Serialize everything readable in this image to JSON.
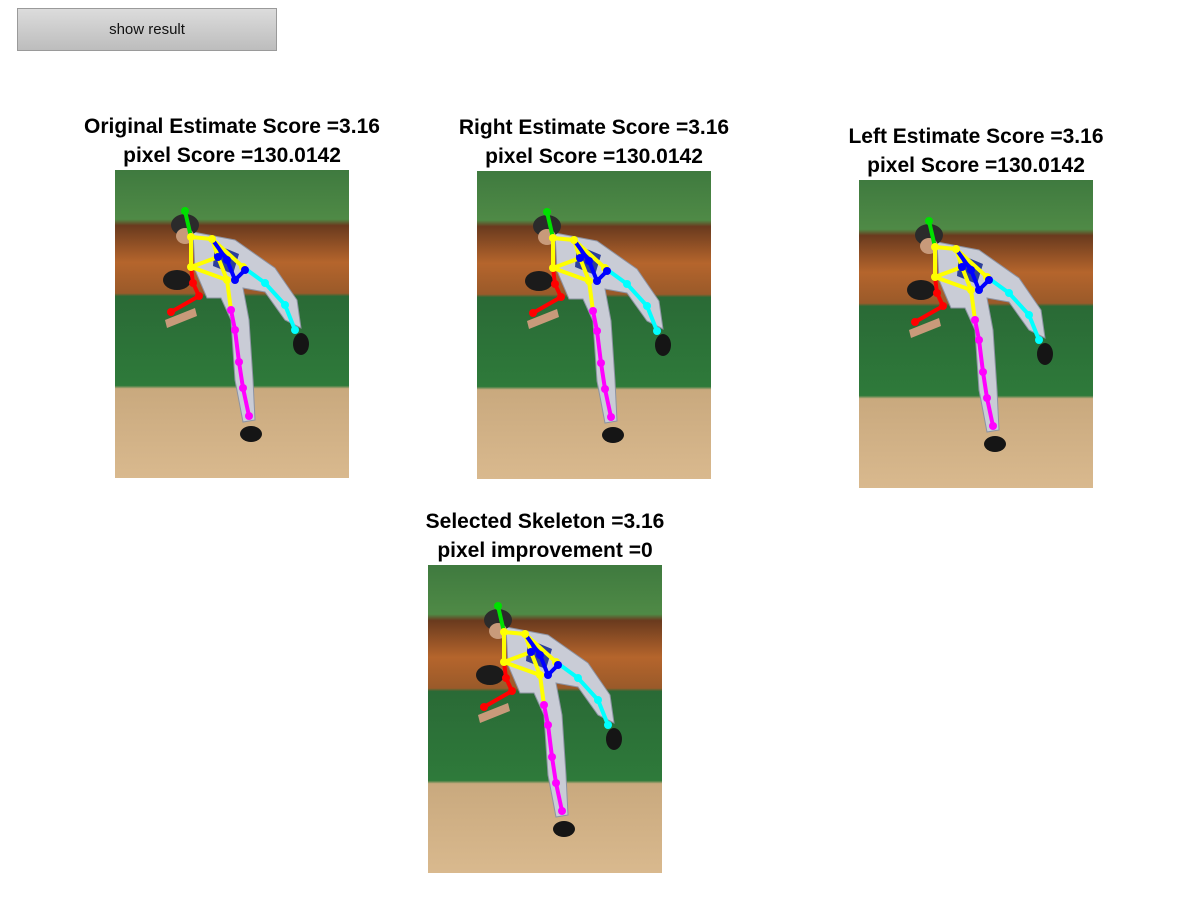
{
  "toolbar": {
    "show_result_label": "show result"
  },
  "panels": [
    {
      "line1": "Original Estimate Score =3.16",
      "line2": "pixel Score =130.0142"
    },
    {
      "line1": "Right Estimate Score =3.16",
      "line2": "pixel Score =130.0142"
    },
    {
      "line1": "Left Estimate Score =3.16",
      "line2": "pixel Score =130.0142"
    },
    {
      "line1": "Selected Skeleton =3.16",
      "line2": "pixel improvement =0"
    }
  ],
  "skeleton_colors": {
    "head": "#00e000",
    "torso": "#ffff00",
    "right_arm": "#ff0000",
    "left_arm": "#0000ff",
    "right_leg": "#00ffff",
    "left_leg": "#ff00ff"
  }
}
